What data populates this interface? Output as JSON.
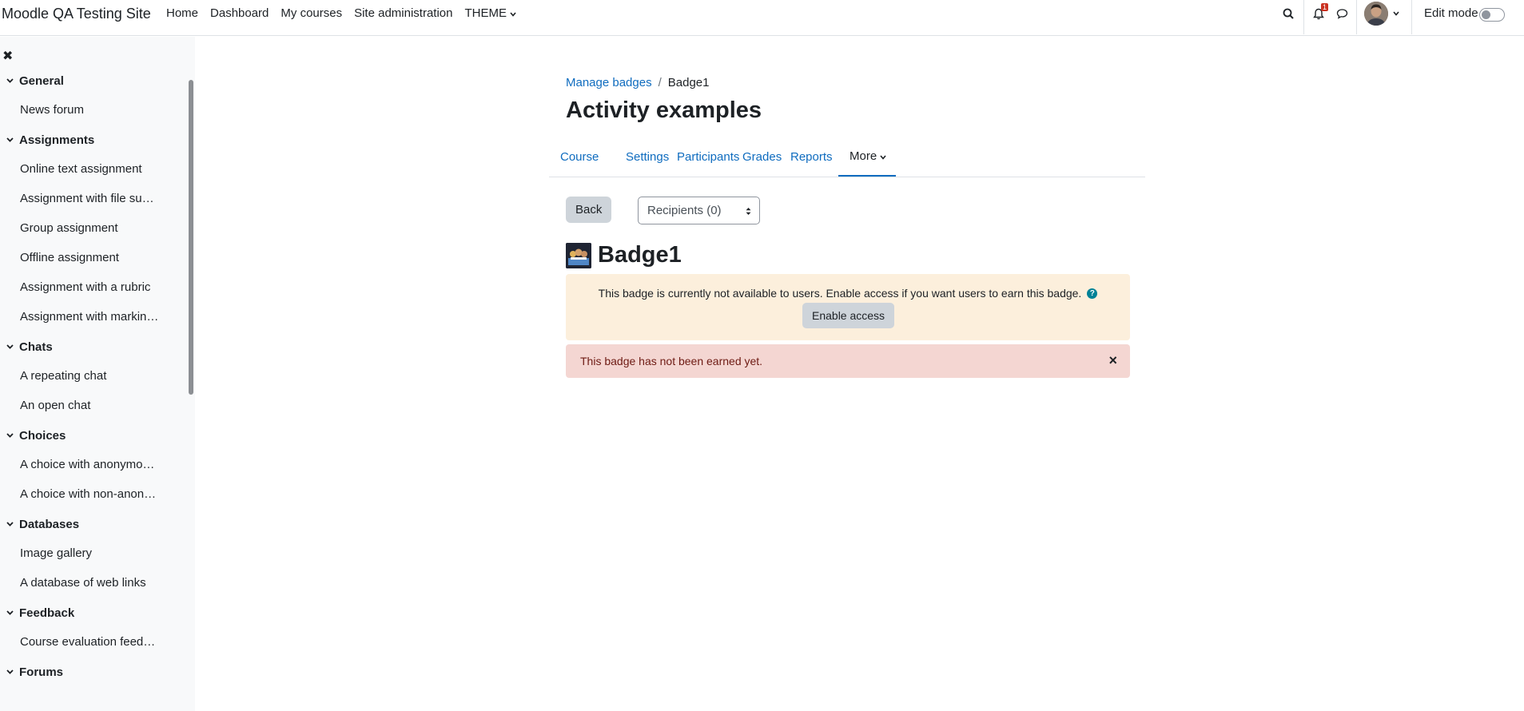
{
  "site": {
    "name": "Moodle QA Testing Site"
  },
  "primary_nav": {
    "items": [
      "Home",
      "Dashboard",
      "My courses",
      "Site administration"
    ],
    "theme_label": "THEME"
  },
  "user_menu": {
    "notification_count": "1",
    "edit_mode_label": "Edit mode",
    "edit_mode_on": false
  },
  "drawer": {
    "close_glyph": "✖",
    "sections": [
      {
        "title": "General",
        "items": [
          "News forum"
        ]
      },
      {
        "title": "Assignments",
        "items": [
          "Online text assignment",
          "Assignment with file submi...",
          "Group assignment",
          "Offline assignment",
          "Assignment with a rubric",
          "Assignment with marking ..."
        ]
      },
      {
        "title": "Chats",
        "items": [
          "A repeating chat",
          "An open chat"
        ]
      },
      {
        "title": "Choices",
        "items": [
          "A choice with anonymous ...",
          "A choice with non-anonym..."
        ]
      },
      {
        "title": "Databases",
        "items": [
          "Image gallery",
          "A database of web links"
        ]
      },
      {
        "title": "Feedback",
        "items": [
          "Course evaluation feedback"
        ]
      },
      {
        "title": "Forums",
        "items": []
      }
    ]
  },
  "breadcrumb": {
    "parent": "Manage badges",
    "current": "Badge1"
  },
  "page_title": "Activity examples",
  "secondary_nav": {
    "tabs": [
      "Course",
      "Settings",
      "Participants",
      "Grades",
      "Reports"
    ],
    "more_label": "More"
  },
  "actions": {
    "back_label": "Back",
    "recipients_selected": "Recipients (0)"
  },
  "badge": {
    "name": "Badge1"
  },
  "alerts": {
    "warning_text": "This badge is currently not available to users. Enable access if you want users to earn this badge.",
    "enable_access_label": "Enable access",
    "danger_text": "This badge has not been earned yet.",
    "close_glyph": "×"
  },
  "icons": {
    "search": "search-icon",
    "notifications": "bell-icon",
    "messages": "chat-bubble-icon",
    "help": "question-circle-icon"
  },
  "colors": {
    "link": "#0f6cbf",
    "warning_bg": "#fcefdc",
    "danger_bg": "#f4d6d2",
    "danger_text": "#6e1a13",
    "badge_count": "#ca3120",
    "help_icon": "#008196"
  }
}
